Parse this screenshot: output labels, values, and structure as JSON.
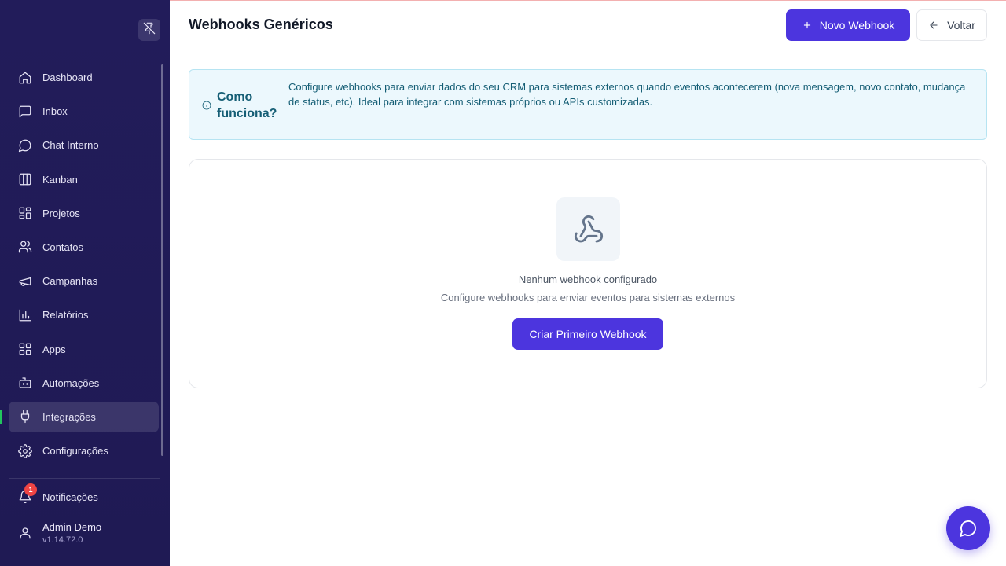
{
  "sidebar": {
    "pin_icon": "pin-off-icon",
    "items": [
      {
        "label": "Dashboard",
        "icon": "home-icon",
        "active": false
      },
      {
        "label": "Inbox",
        "icon": "message-square-icon",
        "active": false
      },
      {
        "label": "Chat Interno",
        "icon": "message-circle-icon",
        "active": false
      },
      {
        "label": "Kanban",
        "icon": "columns-icon",
        "active": false
      },
      {
        "label": "Projetos",
        "icon": "layout-grid-icon",
        "active": false
      },
      {
        "label": "Contatos",
        "icon": "users-icon",
        "active": false
      },
      {
        "label": "Campanhas",
        "icon": "megaphone-icon",
        "active": false
      },
      {
        "label": "Relatórios",
        "icon": "bar-chart-icon",
        "active": false
      },
      {
        "label": "Apps",
        "icon": "grid-icon",
        "active": false
      },
      {
        "label": "Automações",
        "icon": "bot-icon",
        "active": false
      },
      {
        "label": "Integrações",
        "icon": "plug-icon",
        "active": true
      },
      {
        "label": "Configurações",
        "icon": "settings-icon",
        "active": false
      }
    ],
    "notifications": {
      "label": "Notificações",
      "count": "1"
    },
    "user": {
      "name": "Admin Demo",
      "version": "v1.14.72.0"
    },
    "active_indicator_color": "#22c55e"
  },
  "header": {
    "title": "Webhooks Genéricos",
    "new_button": "Novo Webhook",
    "back_button": "Voltar"
  },
  "info": {
    "title": "Como funciona?",
    "text": "Configure webhooks para enviar dados do seu CRM para sistemas externos quando eventos acontecerem (nova mensagem, novo contato, mudança de status, etc). Ideal para integrar com sistemas próprios ou APIs customizadas."
  },
  "empty_state": {
    "icon": "webhook-icon",
    "title": "Nenhum webhook configurado",
    "subtitle": "Configure webhooks para enviar eventos para sistemas externos",
    "button": "Criar Primeiro Webhook"
  },
  "chat_fab": {
    "icon": "chat-bubble-icon"
  },
  "colors": {
    "sidebar_bg": "#221c5a",
    "primary": "#4c35de",
    "info_bg": "#ecf8fd",
    "info_text": "#155e75",
    "badge": "#ef4444"
  }
}
